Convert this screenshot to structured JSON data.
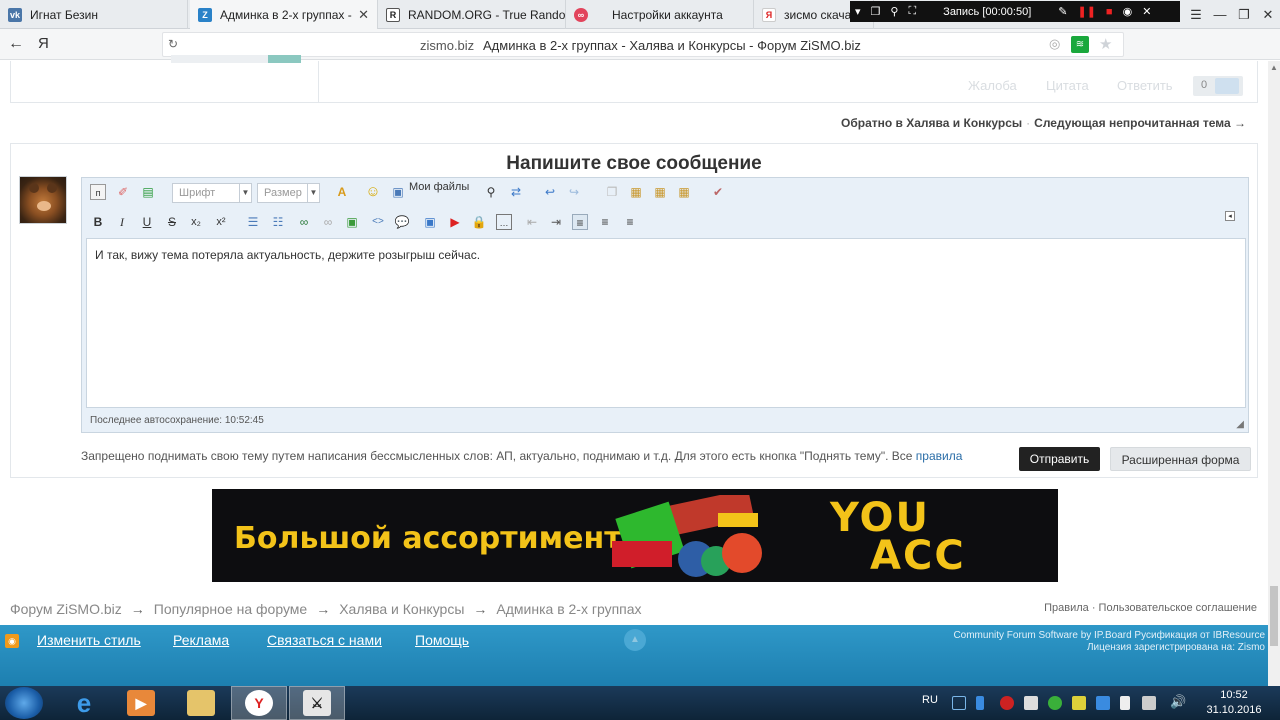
{
  "browser": {
    "tabs": [
      {
        "label": "Игнат Безин",
        "icon": "vk-icon"
      },
      {
        "label": "Админка в 2-х группах -",
        "icon": "zismo-icon"
      },
      {
        "label": "RANDOM.ORG - True Rando",
        "icon": "random-org-icon"
      },
      {
        "label": "Настройки аккаунта",
        "icon": "settings-site-icon"
      },
      {
        "label": "зисмо скача",
        "icon": "yandex-icon"
      }
    ],
    "recording_label": "Запись [00:00:50]",
    "yandex_letter": "Я",
    "address_domain": "zismo.biz",
    "address_title": "Админка в 2-х группах - Халява и Конкурсы - Форум ZiSMO.biz"
  },
  "post_actions": {
    "complaint": "Жалоба",
    "quote": "Цитата",
    "reply": "Ответить",
    "likes": "0"
  },
  "topic_nav": {
    "back": "Обратно в Халява и Конкурсы",
    "next": "Следующая непрочитанная тема →"
  },
  "editor": {
    "heading": "Напишите свое сообщение",
    "font_placeholder": "Шрифт",
    "size_placeholder": "Размер",
    "my_files": "Мои файлы",
    "text": "И так, вижу тема потеряла актуальность, держите розыгрыш сейчас.",
    "autosave": "Последнее автосохранение: 10:52:45",
    "rules_text": "Запрещено поднимать свою тему путем написания бессмысленных слов: АП, актуально, поднимаю и т.д. Для этого есть кнопка \"Поднять тему\". Все",
    "rules_link": "правила",
    "send": "Отправить",
    "advanced": "Расширенная форма"
  },
  "banner": {
    "text": "Большой ассортимент",
    "you": "YOU",
    "acc": "ACC"
  },
  "breadcrumbs": [
    "Форум ZiSMO.biz",
    "Популярное на форуме",
    "Халява и Конкурсы",
    "Админка в 2-х группах"
  ],
  "breadcrumb_sep": "→",
  "footer_links_right": "Правила · Пользовательское соглашение",
  "footer": {
    "links": [
      "Изменить стиль",
      "Реклама",
      "Связаться с нами",
      "Помощь"
    ],
    "credit1": "Community Forum Software by IP.Board Русификация от IBResource",
    "credit2": "Лицензия зарегистрирована на: Zismo"
  },
  "taskbar": {
    "lang": "RU",
    "time": "10:52",
    "date": "31.10.2016"
  },
  "colors": {
    "accent": "#1d7fb0",
    "send_button": "#222222",
    "link": "#2b6ea8"
  }
}
